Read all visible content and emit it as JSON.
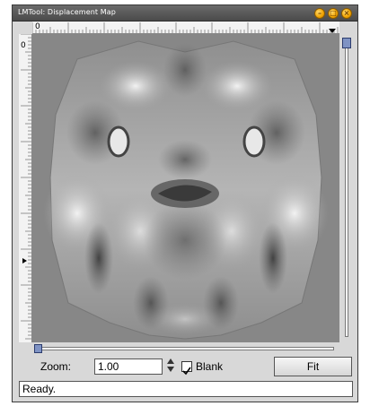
{
  "window": {
    "title": "LMTool: Displacement Map"
  },
  "title_buttons": [
    {
      "name": "minimize-button",
      "icon": "minimize-icon"
    },
    {
      "name": "maximize-button",
      "icon": "maximize-icon"
    },
    {
      "name": "close-button",
      "icon": "close-icon"
    }
  ],
  "rulers": {
    "top_origin": "0",
    "left_origin": "0"
  },
  "image": {
    "content": "grayscale displacement map of a face"
  },
  "controls": {
    "zoom_label": "Zoom:",
    "zoom_value": "1.00",
    "blank_label": "Blank",
    "blank_checked": true,
    "fit_label": "Fit"
  },
  "status": {
    "text": "Ready."
  }
}
